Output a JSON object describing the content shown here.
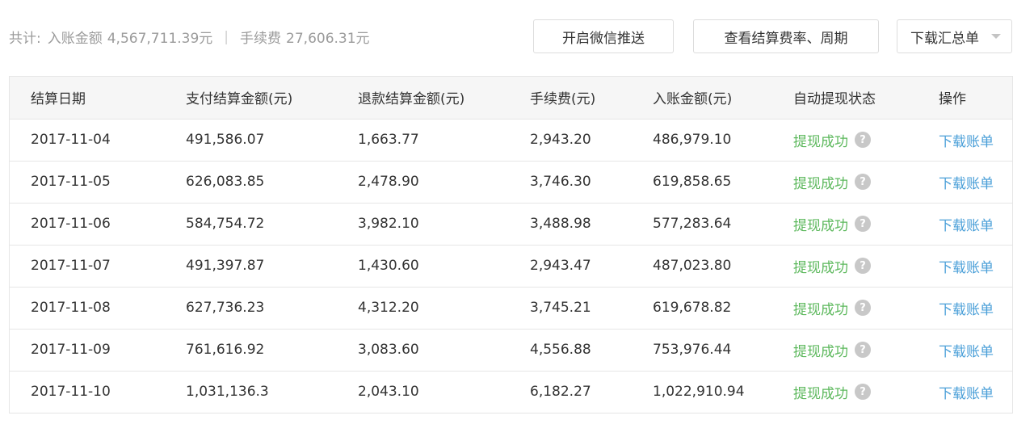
{
  "summary": {
    "total_label": "共计:",
    "income_label": "入账金额",
    "income_value": "4,567,711.39元",
    "separator": "|",
    "fee_label": "手续费",
    "fee_value": "27,606.31元"
  },
  "toolbar": {
    "wechat_push_label": "开启微信推送",
    "view_rate_label": "查看结算费率、周期",
    "download_summary_label": "下载汇总单"
  },
  "table": {
    "headers": [
      "结算日期",
      "支付结算金额(元)",
      "退款结算金额(元)",
      "手续费(元)",
      "入账金额(元)",
      "自动提现状态",
      "操作"
    ],
    "rows": [
      {
        "date": "2017-11-04",
        "pay": "491,586.07",
        "refund": "1,663.77",
        "fee": "2,943.20",
        "income": "486,979.10",
        "status": "提现成功",
        "action": "下载账单"
      },
      {
        "date": "2017-11-05",
        "pay": "626,083.85",
        "refund": "2,478.90",
        "fee": "3,746.30",
        "income": "619,858.65",
        "status": "提现成功",
        "action": "下载账单"
      },
      {
        "date": "2017-11-06",
        "pay": "584,754.72",
        "refund": "3,982.10",
        "fee": "3,488.98",
        "income": "577,283.64",
        "status": "提现成功",
        "action": "下载账单"
      },
      {
        "date": "2017-11-07",
        "pay": "491,397.87",
        "refund": "1,430.60",
        "fee": "2,943.47",
        "income": "487,023.80",
        "status": "提现成功",
        "action": "下载账单"
      },
      {
        "date": "2017-11-08",
        "pay": "627,736.23",
        "refund": "4,312.20",
        "fee": "3,745.21",
        "income": "619,678.82",
        "status": "提现成功",
        "action": "下载账单"
      },
      {
        "date": "2017-11-09",
        "pay": "761,616.92",
        "refund": "3,083.60",
        "fee": "4,556.88",
        "income": "753,976.44",
        "status": "提现成功",
        "action": "下载账单"
      },
      {
        "date": "2017-11-10",
        "pay": "1,031,136.3",
        "refund": "2,043.10",
        "fee": "6,182.27",
        "income": "1,022,910.94",
        "status": "提现成功",
        "action": "下载账单"
      }
    ]
  },
  "icons": {
    "help": "question-circle-icon",
    "dropdown": "chevron-down-icon",
    "help_glyph": "?"
  },
  "colors": {
    "status_success": "#5cb85c",
    "link": "#4a9fd8",
    "header_bg": "#f6f6f6"
  }
}
